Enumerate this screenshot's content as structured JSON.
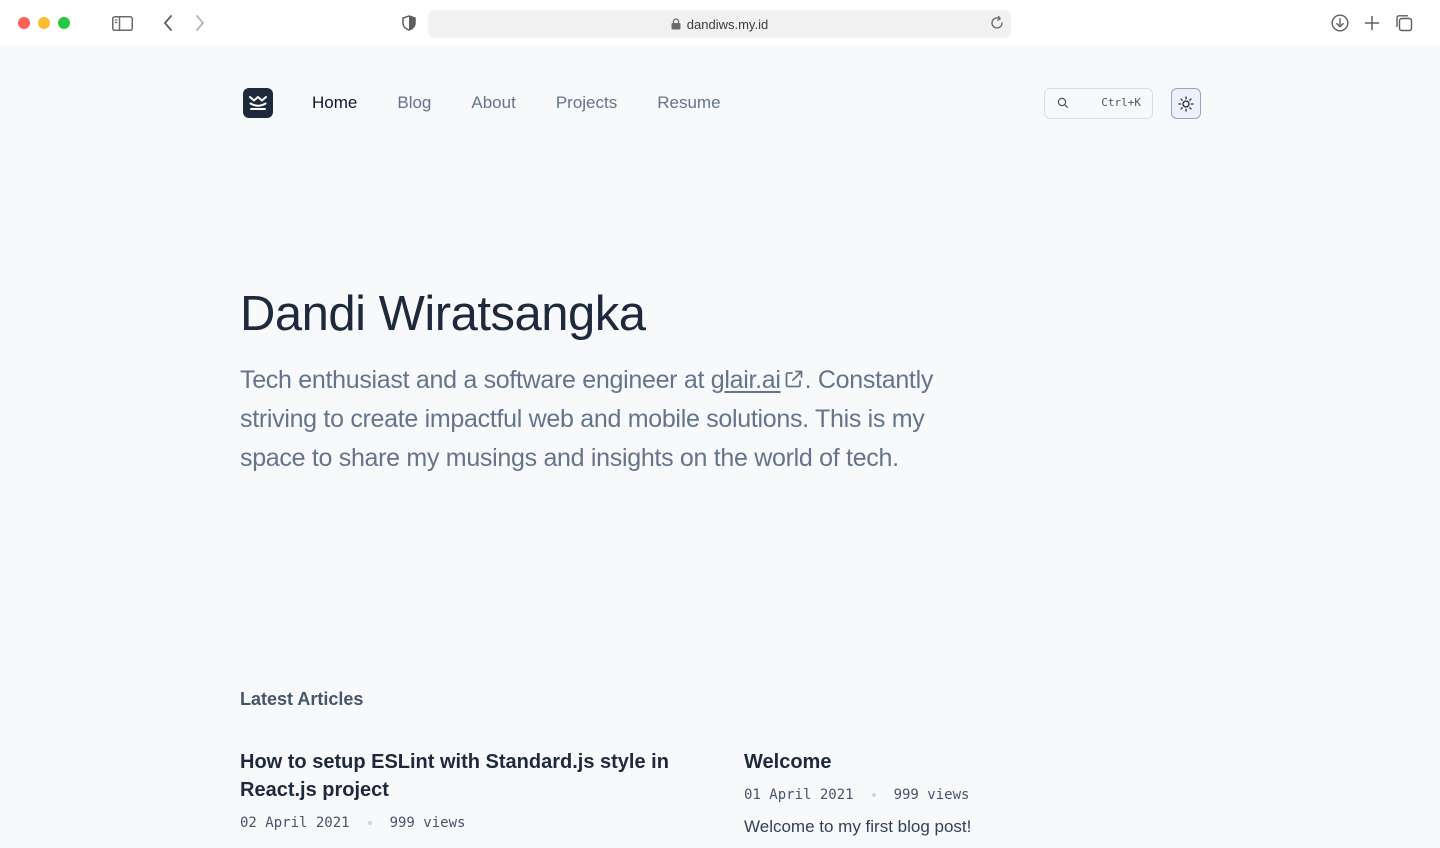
{
  "browser": {
    "url": "dandiws.my.id"
  },
  "nav": {
    "links": [
      {
        "label": "Home",
        "active": true
      },
      {
        "label": "Blog",
        "active": false
      },
      {
        "label": "About",
        "active": false
      },
      {
        "label": "Projects",
        "active": false
      },
      {
        "label": "Resume",
        "active": false
      }
    ],
    "search_shortcut": "Ctrl+K",
    "theme_icon": "sun-icon"
  },
  "hero": {
    "name": "Dandi Wiratsangka",
    "bio_before": "Tech enthusiast and a software engineer at ",
    "bio_link": "glair.ai",
    "bio_after": ". Constantly striving to create impactful web and mobile solutions. This is my space to share my musings and insights on the world of tech."
  },
  "latest": {
    "heading": "Latest Articles",
    "articles": [
      {
        "title": "How to setup ESLint with Standard.js style in React.js project",
        "date": "02 April 2021",
        "views": "999 views",
        "excerpt": ""
      },
      {
        "title": "Welcome",
        "date": "01 April 2021",
        "views": "999 views",
        "excerpt": "Welcome to my first blog post!"
      }
    ]
  },
  "colors": {
    "page_bg": "#f8f9fb",
    "text_dark": "#1e293b",
    "text_muted": "#64748b"
  }
}
